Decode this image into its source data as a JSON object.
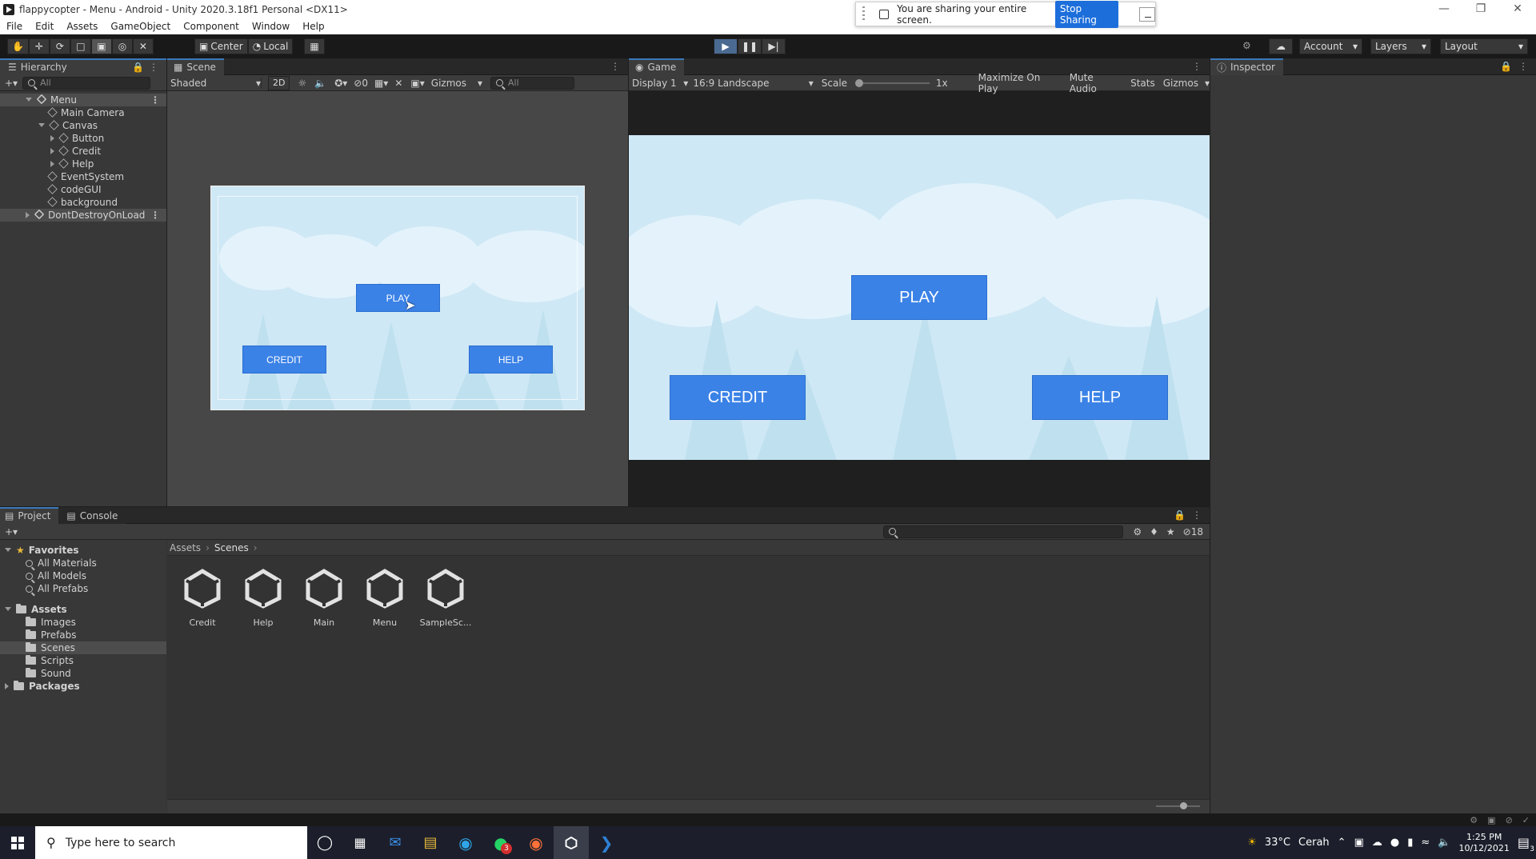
{
  "window": {
    "title": "flappycopter - Menu - Android - Unity 2020.3.18f1 Personal <DX11>"
  },
  "share_bar": {
    "message": "You are sharing your entire screen.",
    "stop_label": "Stop Sharing"
  },
  "menu": [
    "File",
    "Edit",
    "Assets",
    "GameObject",
    "Component",
    "Window",
    "Help"
  ],
  "toolbar": {
    "pivot": "Center",
    "space": "Local",
    "account": "Account",
    "layers": "Layers",
    "layout": "Layout"
  },
  "hierarchy": {
    "tab": "Hierarchy",
    "search_placeholder": "All",
    "items": [
      "Menu",
      "Main Camera",
      "Canvas",
      "Button",
      "Credit",
      "Help",
      "EventSystem",
      "codeGUI",
      "background",
      "DontDestroyOnLoad"
    ]
  },
  "scene": {
    "tab": "Scene",
    "shading": "Shaded",
    "mode2d": "2D",
    "hidden_count": "0",
    "gizmos": "Gizmos",
    "search_placeholder": "All",
    "buttons": {
      "play": "PLAY",
      "credit": "CREDIT",
      "help": "HELP"
    }
  },
  "game": {
    "tab": "Game",
    "display": "Display 1",
    "aspect": "16:9 Landscape",
    "scale_label": "Scale",
    "scale_value": "1x",
    "maximize": "Maximize On Play",
    "mute": "Mute Audio",
    "stats": "Stats",
    "gizmos": "Gizmos",
    "buttons": {
      "play": "PLAY",
      "credit": "CREDIT",
      "help": "HELP"
    }
  },
  "inspector": {
    "tab": "Inspector"
  },
  "project": {
    "tabs": [
      "Project",
      "Console"
    ],
    "hidden_count": "18",
    "favorites": {
      "label": "Favorites",
      "items": [
        "All Materials",
        "All Models",
        "All Prefabs"
      ]
    },
    "assets": {
      "label": "Assets",
      "items": [
        "Images",
        "Prefabs",
        "Scenes",
        "Scripts",
        "Sound"
      ]
    },
    "packages": "Packages",
    "breadcrumb": [
      "Assets",
      "Scenes"
    ],
    "files": [
      "Credit",
      "Help",
      "Main",
      "Menu",
      "SampleSc..."
    ]
  },
  "taskbar": {
    "search_placeholder": "Type here to search",
    "weather": "33°C",
    "weather_text": "Cerah",
    "time": "1:25 PM",
    "date": "10/12/2021",
    "whatsapp_badge": "3",
    "notif_badge": "3"
  },
  "colors": {
    "accent": "#3a79bb",
    "game_button": "#3b82e7",
    "sky": "#cfe8f5"
  }
}
